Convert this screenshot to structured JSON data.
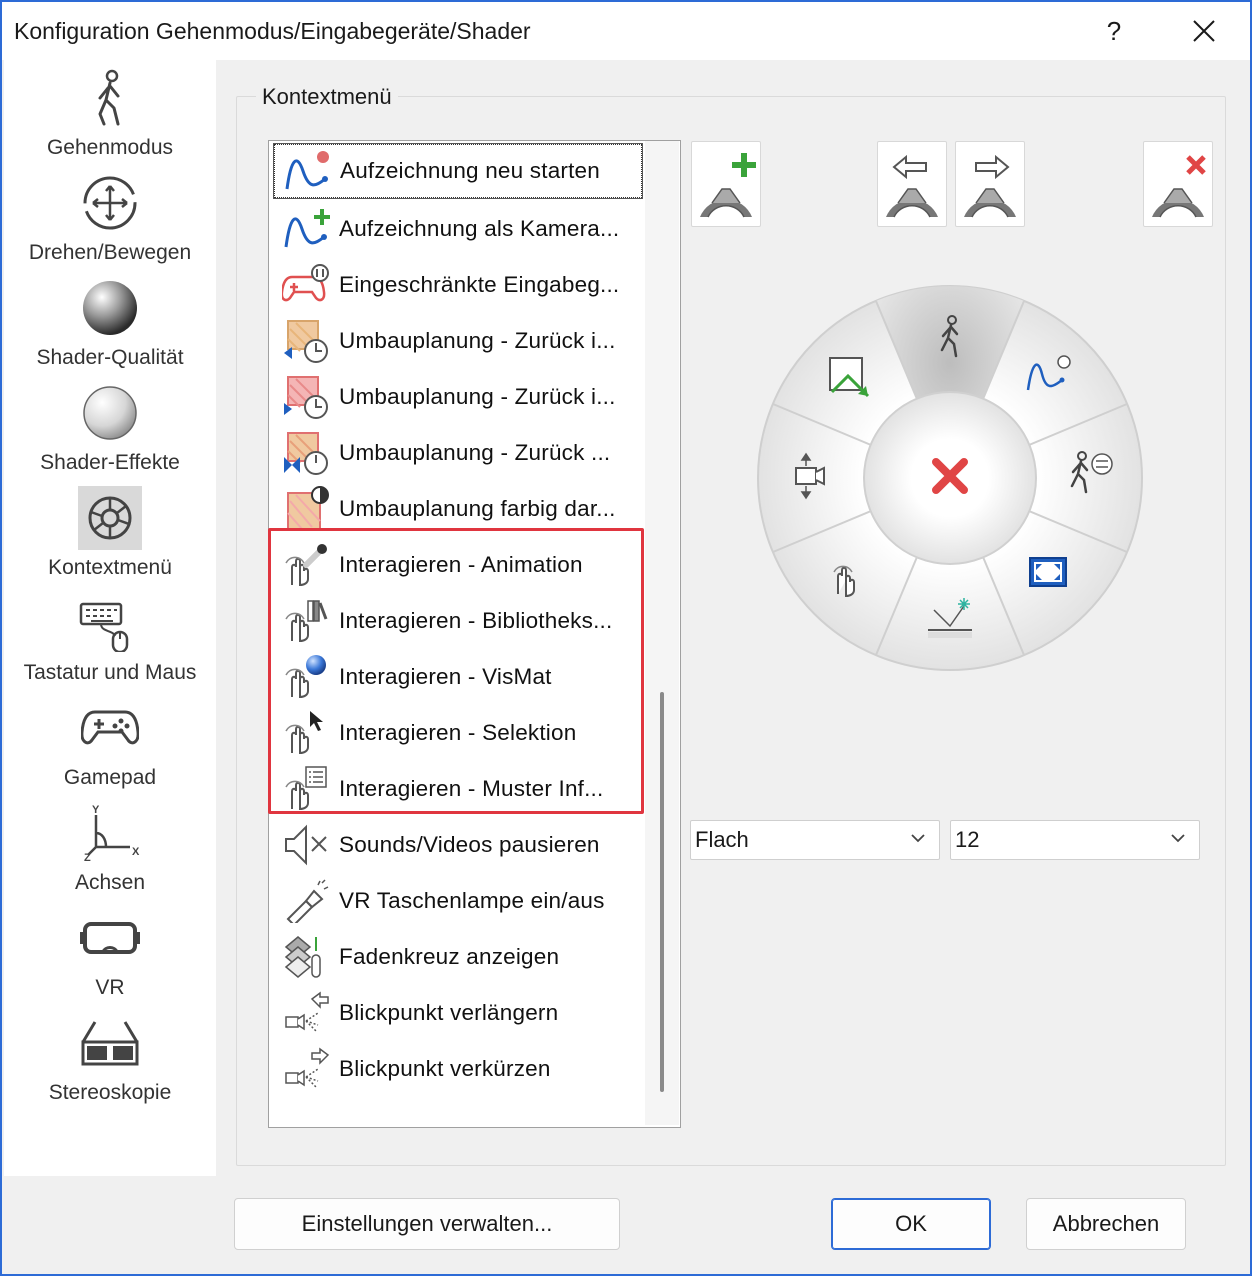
{
  "window": {
    "title": "Konfiguration Gehenmodus/Eingabegeräte/Shader",
    "help_glyph": "?",
    "close_glyph": "✕"
  },
  "sidebar": {
    "items": [
      {
        "label": "Gehenmodus",
        "icon": "walking-person-icon"
      },
      {
        "label": "Drehen/Bewegen",
        "icon": "move-arrows-icon"
      },
      {
        "label": "Shader-Qualität",
        "icon": "shaded-sphere-icon"
      },
      {
        "label": "Shader-Effekte",
        "icon": "light-sphere-icon"
      },
      {
        "label": "Kontextmenü",
        "icon": "pie-menu-icon",
        "selected": true
      },
      {
        "label": "Tastatur und Maus",
        "icon": "keyboard-mouse-icon"
      },
      {
        "label": "Gamepad",
        "icon": "gamepad-icon"
      },
      {
        "label": "Achsen",
        "icon": "axes-icon"
      },
      {
        "label": "VR",
        "icon": "vr-headset-icon"
      },
      {
        "label": "Stereoskopie",
        "icon": "3d-glasses-icon"
      }
    ]
  },
  "group": {
    "title": "Kontextmenü"
  },
  "list": {
    "items": [
      {
        "label": "Aufzeichnung neu starten",
        "icon": "recording-restart-icon",
        "focused": true
      },
      {
        "label": "Aufzeichnung als Kamera...",
        "icon": "recording-add-camera-icon"
      },
      {
        "label": "Eingeschränkte Eingabeg...",
        "icon": "gamepad-pause-icon"
      },
      {
        "label": "Umbauplanung - Zurück i...",
        "icon": "rebuild-back-icon"
      },
      {
        "label": "Umbauplanung - Zurück i...",
        "icon": "rebuild-forward-icon"
      },
      {
        "label": "Umbauplanung - Zurück ...",
        "icon": "rebuild-both-icon"
      },
      {
        "label": "Umbauplanung farbig dar...",
        "icon": "rebuild-color-icon"
      },
      {
        "label": "Interagieren - Animation",
        "icon": "interact-animation-icon"
      },
      {
        "label": "Interagieren - Bibliotheks...",
        "icon": "interact-library-icon"
      },
      {
        "label": "Interagieren - VisMat",
        "icon": "interact-vismat-icon"
      },
      {
        "label": "Interagieren - Selektion",
        "icon": "interact-selection-icon"
      },
      {
        "label": "Interagieren - Muster Inf...",
        "icon": "interact-pattern-icon"
      },
      {
        "label": "Sounds/Videos pausieren",
        "icon": "mute-icon"
      },
      {
        "label": "VR Taschenlampe ein/aus",
        "icon": "flashlight-icon"
      },
      {
        "label": "Fadenkreuz anzeigen",
        "icon": "crosshair-layers-icon"
      },
      {
        "label": "Blickpunkt verlängern",
        "icon": "viewpoint-extend-icon"
      },
      {
        "label": "Blickpunkt verkürzen",
        "icon": "viewpoint-shorten-icon"
      }
    ]
  },
  "toolbar": {
    "buttons": [
      {
        "name": "add-segment-button",
        "icon": "pie-add-icon"
      },
      {
        "name": "move-left-button",
        "icon": "pie-move-left-icon"
      },
      {
        "name": "move-right-button",
        "icon": "pie-move-right-icon"
      },
      {
        "name": "remove-segment-button",
        "icon": "pie-remove-icon"
      }
    ]
  },
  "pie_menu": {
    "segments": [
      {
        "icon": "walking-person-icon",
        "selected": true
      },
      {
        "icon": "recording-icon"
      },
      {
        "icon": "walk-settings-icon"
      },
      {
        "icon": "fullscreen-icon"
      },
      {
        "icon": "surface-light-icon"
      },
      {
        "icon": "interact-hand-icon"
      },
      {
        "icon": "camera-move-icon"
      },
      {
        "icon": "view-arrow-icon"
      }
    ],
    "center_icon": "close-x-icon"
  },
  "style_select": {
    "value": "Flach"
  },
  "size_select": {
    "value": "12"
  },
  "footer": {
    "manage_label": "Einstellungen verwalten...",
    "ok_label": "OK",
    "cancel_label": "Abbrechen"
  },
  "colors": {
    "window_border": "#2d6bd6",
    "highlight": "#e0353f",
    "accent_green": "#3aa33a",
    "accent_red": "#e04545"
  }
}
